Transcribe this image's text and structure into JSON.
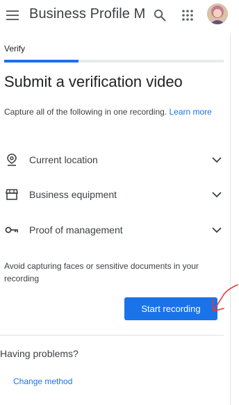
{
  "appbar": {
    "title": "Business Profile Ma",
    "menu_icon": "menu-icon",
    "search_icon": "search-icon",
    "apps_icon": "apps-grid-icon",
    "avatar": "avatar"
  },
  "step": {
    "label": "Verify",
    "progress": 0.34
  },
  "main": {
    "heading": "Submit a verification video",
    "intro_text": "Capture all of the following in one recording.",
    "learn_more": "Learn more",
    "items": [
      {
        "label": "Current location",
        "icon": "location-pin-icon"
      },
      {
        "label": "Business equipment",
        "icon": "storefront-icon"
      },
      {
        "label": "Proof of management",
        "icon": "key-icon"
      }
    ],
    "note": "Avoid capturing faces or sensitive documents in your recording",
    "start_button": "Start recording"
  },
  "help": {
    "title": "Having problems?",
    "change_method": "Change method"
  },
  "colors": {
    "accent": "#1a73e8",
    "annotation": "#e53935"
  }
}
